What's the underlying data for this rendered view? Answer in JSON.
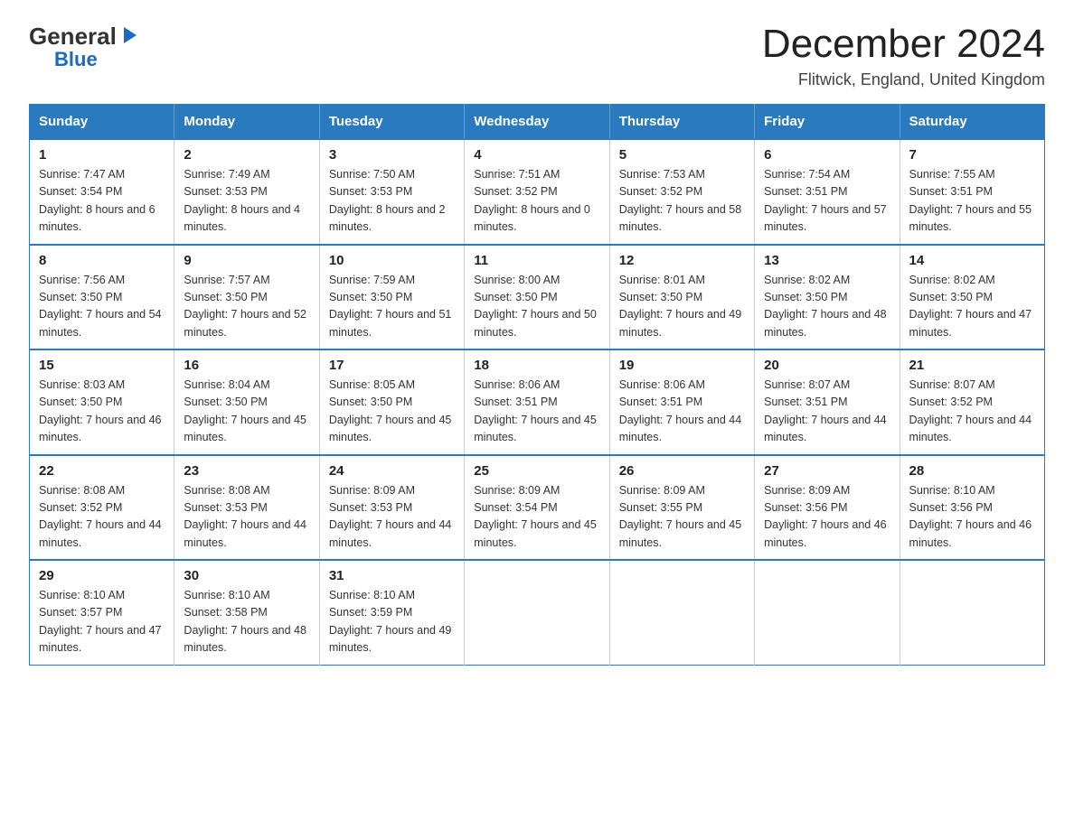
{
  "logo": {
    "general": "General",
    "arrow": "▶",
    "blue": "Blue"
  },
  "header": {
    "title": "December 2024",
    "subtitle": "Flitwick, England, United Kingdom"
  },
  "weekdays": [
    "Sunday",
    "Monday",
    "Tuesday",
    "Wednesday",
    "Thursday",
    "Friday",
    "Saturday"
  ],
  "weeks": [
    [
      {
        "day": "1",
        "sunrise": "7:47 AM",
        "sunset": "3:54 PM",
        "daylight": "8 hours and 6 minutes."
      },
      {
        "day": "2",
        "sunrise": "7:49 AM",
        "sunset": "3:53 PM",
        "daylight": "8 hours and 4 minutes."
      },
      {
        "day": "3",
        "sunrise": "7:50 AM",
        "sunset": "3:53 PM",
        "daylight": "8 hours and 2 minutes."
      },
      {
        "day": "4",
        "sunrise": "7:51 AM",
        "sunset": "3:52 PM",
        "daylight": "8 hours and 0 minutes."
      },
      {
        "day": "5",
        "sunrise": "7:53 AM",
        "sunset": "3:52 PM",
        "daylight": "7 hours and 58 minutes."
      },
      {
        "day": "6",
        "sunrise": "7:54 AM",
        "sunset": "3:51 PM",
        "daylight": "7 hours and 57 minutes."
      },
      {
        "day": "7",
        "sunrise": "7:55 AM",
        "sunset": "3:51 PM",
        "daylight": "7 hours and 55 minutes."
      }
    ],
    [
      {
        "day": "8",
        "sunrise": "7:56 AM",
        "sunset": "3:50 PM",
        "daylight": "7 hours and 54 minutes."
      },
      {
        "day": "9",
        "sunrise": "7:57 AM",
        "sunset": "3:50 PM",
        "daylight": "7 hours and 52 minutes."
      },
      {
        "day": "10",
        "sunrise": "7:59 AM",
        "sunset": "3:50 PM",
        "daylight": "7 hours and 51 minutes."
      },
      {
        "day": "11",
        "sunrise": "8:00 AM",
        "sunset": "3:50 PM",
        "daylight": "7 hours and 50 minutes."
      },
      {
        "day": "12",
        "sunrise": "8:01 AM",
        "sunset": "3:50 PM",
        "daylight": "7 hours and 49 minutes."
      },
      {
        "day": "13",
        "sunrise": "8:02 AM",
        "sunset": "3:50 PM",
        "daylight": "7 hours and 48 minutes."
      },
      {
        "day": "14",
        "sunrise": "8:02 AM",
        "sunset": "3:50 PM",
        "daylight": "7 hours and 47 minutes."
      }
    ],
    [
      {
        "day": "15",
        "sunrise": "8:03 AM",
        "sunset": "3:50 PM",
        "daylight": "7 hours and 46 minutes."
      },
      {
        "day": "16",
        "sunrise": "8:04 AM",
        "sunset": "3:50 PM",
        "daylight": "7 hours and 45 minutes."
      },
      {
        "day": "17",
        "sunrise": "8:05 AM",
        "sunset": "3:50 PM",
        "daylight": "7 hours and 45 minutes."
      },
      {
        "day": "18",
        "sunrise": "8:06 AM",
        "sunset": "3:51 PM",
        "daylight": "7 hours and 45 minutes."
      },
      {
        "day": "19",
        "sunrise": "8:06 AM",
        "sunset": "3:51 PM",
        "daylight": "7 hours and 44 minutes."
      },
      {
        "day": "20",
        "sunrise": "8:07 AM",
        "sunset": "3:51 PM",
        "daylight": "7 hours and 44 minutes."
      },
      {
        "day": "21",
        "sunrise": "8:07 AM",
        "sunset": "3:52 PM",
        "daylight": "7 hours and 44 minutes."
      }
    ],
    [
      {
        "day": "22",
        "sunrise": "8:08 AM",
        "sunset": "3:52 PM",
        "daylight": "7 hours and 44 minutes."
      },
      {
        "day": "23",
        "sunrise": "8:08 AM",
        "sunset": "3:53 PM",
        "daylight": "7 hours and 44 minutes."
      },
      {
        "day": "24",
        "sunrise": "8:09 AM",
        "sunset": "3:53 PM",
        "daylight": "7 hours and 44 minutes."
      },
      {
        "day": "25",
        "sunrise": "8:09 AM",
        "sunset": "3:54 PM",
        "daylight": "7 hours and 45 minutes."
      },
      {
        "day": "26",
        "sunrise": "8:09 AM",
        "sunset": "3:55 PM",
        "daylight": "7 hours and 45 minutes."
      },
      {
        "day": "27",
        "sunrise": "8:09 AM",
        "sunset": "3:56 PM",
        "daylight": "7 hours and 46 minutes."
      },
      {
        "day": "28",
        "sunrise": "8:10 AM",
        "sunset": "3:56 PM",
        "daylight": "7 hours and 46 minutes."
      }
    ],
    [
      {
        "day": "29",
        "sunrise": "8:10 AM",
        "sunset": "3:57 PM",
        "daylight": "7 hours and 47 minutes."
      },
      {
        "day": "30",
        "sunrise": "8:10 AM",
        "sunset": "3:58 PM",
        "daylight": "7 hours and 48 minutes."
      },
      {
        "day": "31",
        "sunrise": "8:10 AM",
        "sunset": "3:59 PM",
        "daylight": "7 hours and 49 minutes."
      },
      null,
      null,
      null,
      null
    ]
  ]
}
